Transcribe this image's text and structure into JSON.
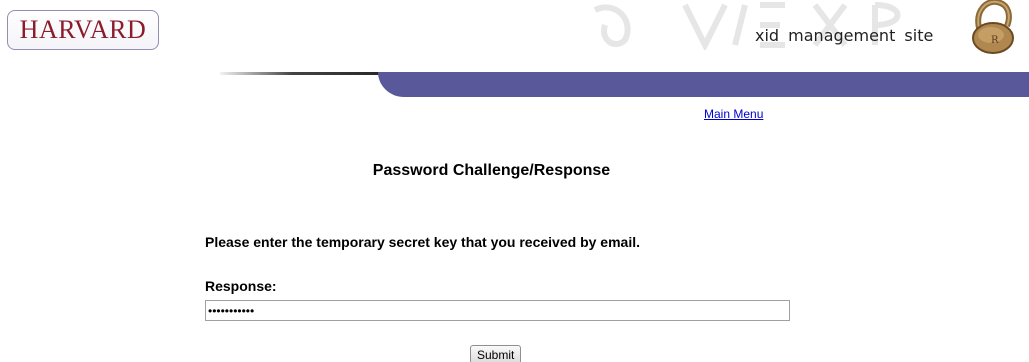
{
  "header": {
    "logo_text": "HARVARD",
    "site_title": "xid  management  site"
  },
  "nav": {
    "main_menu_label": "Main Menu"
  },
  "content": {
    "heading": "Password Challenge/Response",
    "instructions": "Please enter the temporary secret key that you received by email.",
    "response_label": "Response:",
    "response_value": "***********",
    "submit_label": "Submit"
  },
  "colors": {
    "band": "#58589a",
    "logo_text": "#8a1c2b",
    "link": "#0000cc"
  },
  "icons": {
    "lock": "padlock-icon",
    "watermark": "veritas-watermark-icon"
  }
}
